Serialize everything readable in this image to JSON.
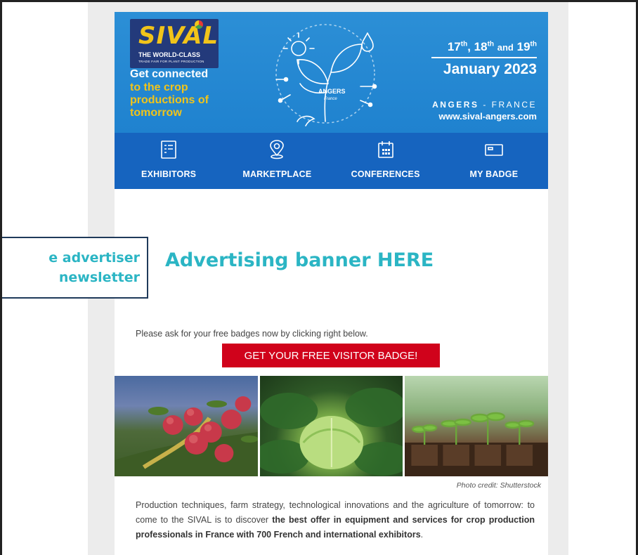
{
  "header": {
    "logo": "SIVAL",
    "logo_sub1": "THE WORLD-CLASS",
    "logo_sub2": "TRADE FAIR FOR PLANT PRODUCTION",
    "tagline_1": "Get connected",
    "tagline_2": "to the crop productions of tomorrow",
    "plant_city": "ANGERS",
    "plant_country": "France",
    "dates_days": [
      "17",
      "18",
      "19"
    ],
    "dates_sups": [
      "th",
      "th",
      "th"
    ],
    "dates_and": "and",
    "dates_month": "January 2023",
    "location_city": "ANGERS",
    "location_country": "- FRANCE",
    "website": "www.sival-angers.com",
    "colors": {
      "hero": "#1f82cf",
      "nav": "#1664bf",
      "accent_yellow": "#f1c41a"
    }
  },
  "nav": {
    "items": [
      {
        "label": "EXHIBITORS",
        "icon": "list-icon"
      },
      {
        "label": "MARKETPLACE",
        "icon": "map-pin-icon"
      },
      {
        "label": "CONFERENCES",
        "icon": "calendar-icon"
      },
      {
        "label": "MY BADGE",
        "icon": "badge-icon"
      }
    ]
  },
  "ad": {
    "text": "Advertising banner HERE",
    "color": "#2bb5c4"
  },
  "callout": {
    "line1": "e advertiser",
    "line2": "newsletter"
  },
  "cta": {
    "intro": "Please ask for your free badges now by clicking right below.",
    "button": "GET YOUR FREE VISITOR BADGE!",
    "button_color": "#d0021b"
  },
  "photos": {
    "items": [
      "apples",
      "cabbage",
      "seedlings"
    ],
    "credit": "Photo credit: Shutterstock"
  },
  "body": {
    "text_1": "Production techniques, farm strategy, technological innovations and the agriculture of tomorrow: to come to the SIVAL is to discover ",
    "text_bold": "the best offer in equipment and services for crop production professionals in France with 700 French and international exhibitors",
    "text_end": "."
  }
}
